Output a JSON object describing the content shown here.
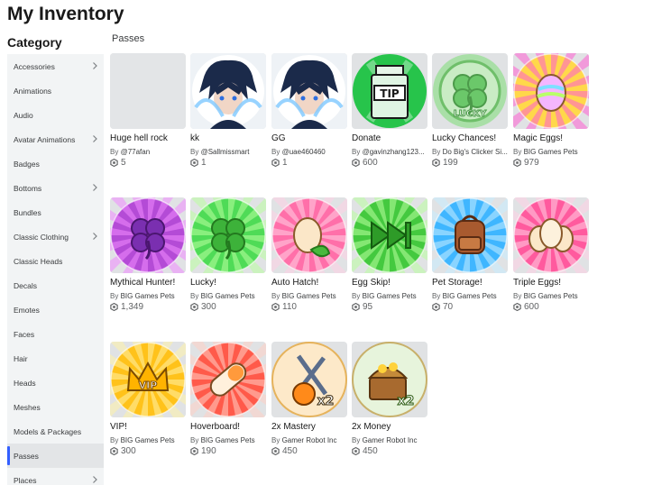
{
  "page": {
    "title": "My Inventory"
  },
  "sidebar": {
    "title": "Category",
    "items": [
      {
        "label": "Accessories",
        "chevron": true
      },
      {
        "label": "Animations",
        "chevron": false
      },
      {
        "label": "Audio",
        "chevron": false
      },
      {
        "label": "Avatar Animations",
        "chevron": true
      },
      {
        "label": "Badges",
        "chevron": false
      },
      {
        "label": "Bottoms",
        "chevron": true
      },
      {
        "label": "Bundles",
        "chevron": false
      },
      {
        "label": "Classic Clothing",
        "chevron": true
      },
      {
        "label": "Classic Heads",
        "chevron": false
      },
      {
        "label": "Decals",
        "chevron": false
      },
      {
        "label": "Emotes",
        "chevron": false
      },
      {
        "label": "Faces",
        "chevron": false
      },
      {
        "label": "Hair",
        "chevron": false
      },
      {
        "label": "Heads",
        "chevron": false
      },
      {
        "label": "Meshes",
        "chevron": false
      },
      {
        "label": "Models & Packages",
        "chevron": false
      },
      {
        "label": "Passes",
        "chevron": false,
        "active": true
      },
      {
        "label": "Places",
        "chevron": true
      }
    ]
  },
  "main": {
    "section_label": "Passes",
    "by_label": "By",
    "items": [
      {
        "name": "Huge hell rock",
        "creator": "@77afan",
        "price": "5",
        "icon": "blank-thumbnail"
      },
      {
        "name": "kk",
        "creator": "@Sallmissmart",
        "price": "1",
        "icon": "anime-character-thumbnail"
      },
      {
        "name": "GG",
        "creator": "@uae460460",
        "price": "1",
        "icon": "anime-character-thumbnail"
      },
      {
        "name": "Donate",
        "creator": "@gavinzhang123...",
        "price": "600",
        "icon": "tip-jar-icon"
      },
      {
        "name": "Lucky Chances!",
        "creator": "Do Big's Clicker Si...",
        "price": "199",
        "icon": "lucky-clover-icon"
      },
      {
        "name": "Magic Eggs!",
        "creator": "BIG Games Pets",
        "price": "979",
        "icon": "rainbow-egg-icon"
      },
      {
        "name": "Mythical Hunter!",
        "creator": "BIG Games Pets",
        "price": "1,349",
        "icon": "purple-clover-icon"
      },
      {
        "name": "Lucky!",
        "creator": "BIG Games Pets",
        "price": "300",
        "icon": "green-clover-icon"
      },
      {
        "name": "Auto Hatch!",
        "creator": "BIG Games Pets",
        "price": "110",
        "icon": "egg-leaf-icon"
      },
      {
        "name": "Egg Skip!",
        "creator": "BIG Games Pets",
        "price": "95",
        "icon": "fast-forward-icon"
      },
      {
        "name": "Pet Storage!",
        "creator": "BIG Games Pets",
        "price": "70",
        "icon": "backpack-icon"
      },
      {
        "name": "Triple Eggs!",
        "creator": "BIG Games Pets",
        "price": "600",
        "icon": "triple-eggs-icon"
      },
      {
        "name": "VIP!",
        "creator": "BIG Games Pets",
        "price": "300",
        "icon": "vip-crown-icon"
      },
      {
        "name": "Hoverboard!",
        "creator": "BIG Games Pets",
        "price": "190",
        "icon": "hoverboard-icon"
      },
      {
        "name": "2x Mastery",
        "creator": "Gamer Robot Inc",
        "price": "450",
        "icon": "mastery-x2-icon"
      },
      {
        "name": "2x Money",
        "creator": "Gamer Robot Inc",
        "price": "450",
        "icon": "money-chest-x2-icon"
      }
    ]
  },
  "overlay_text": {
    "tip": "TIP",
    "lucky": "LUCKY",
    "vip": "VIP",
    "x2": "x2"
  }
}
